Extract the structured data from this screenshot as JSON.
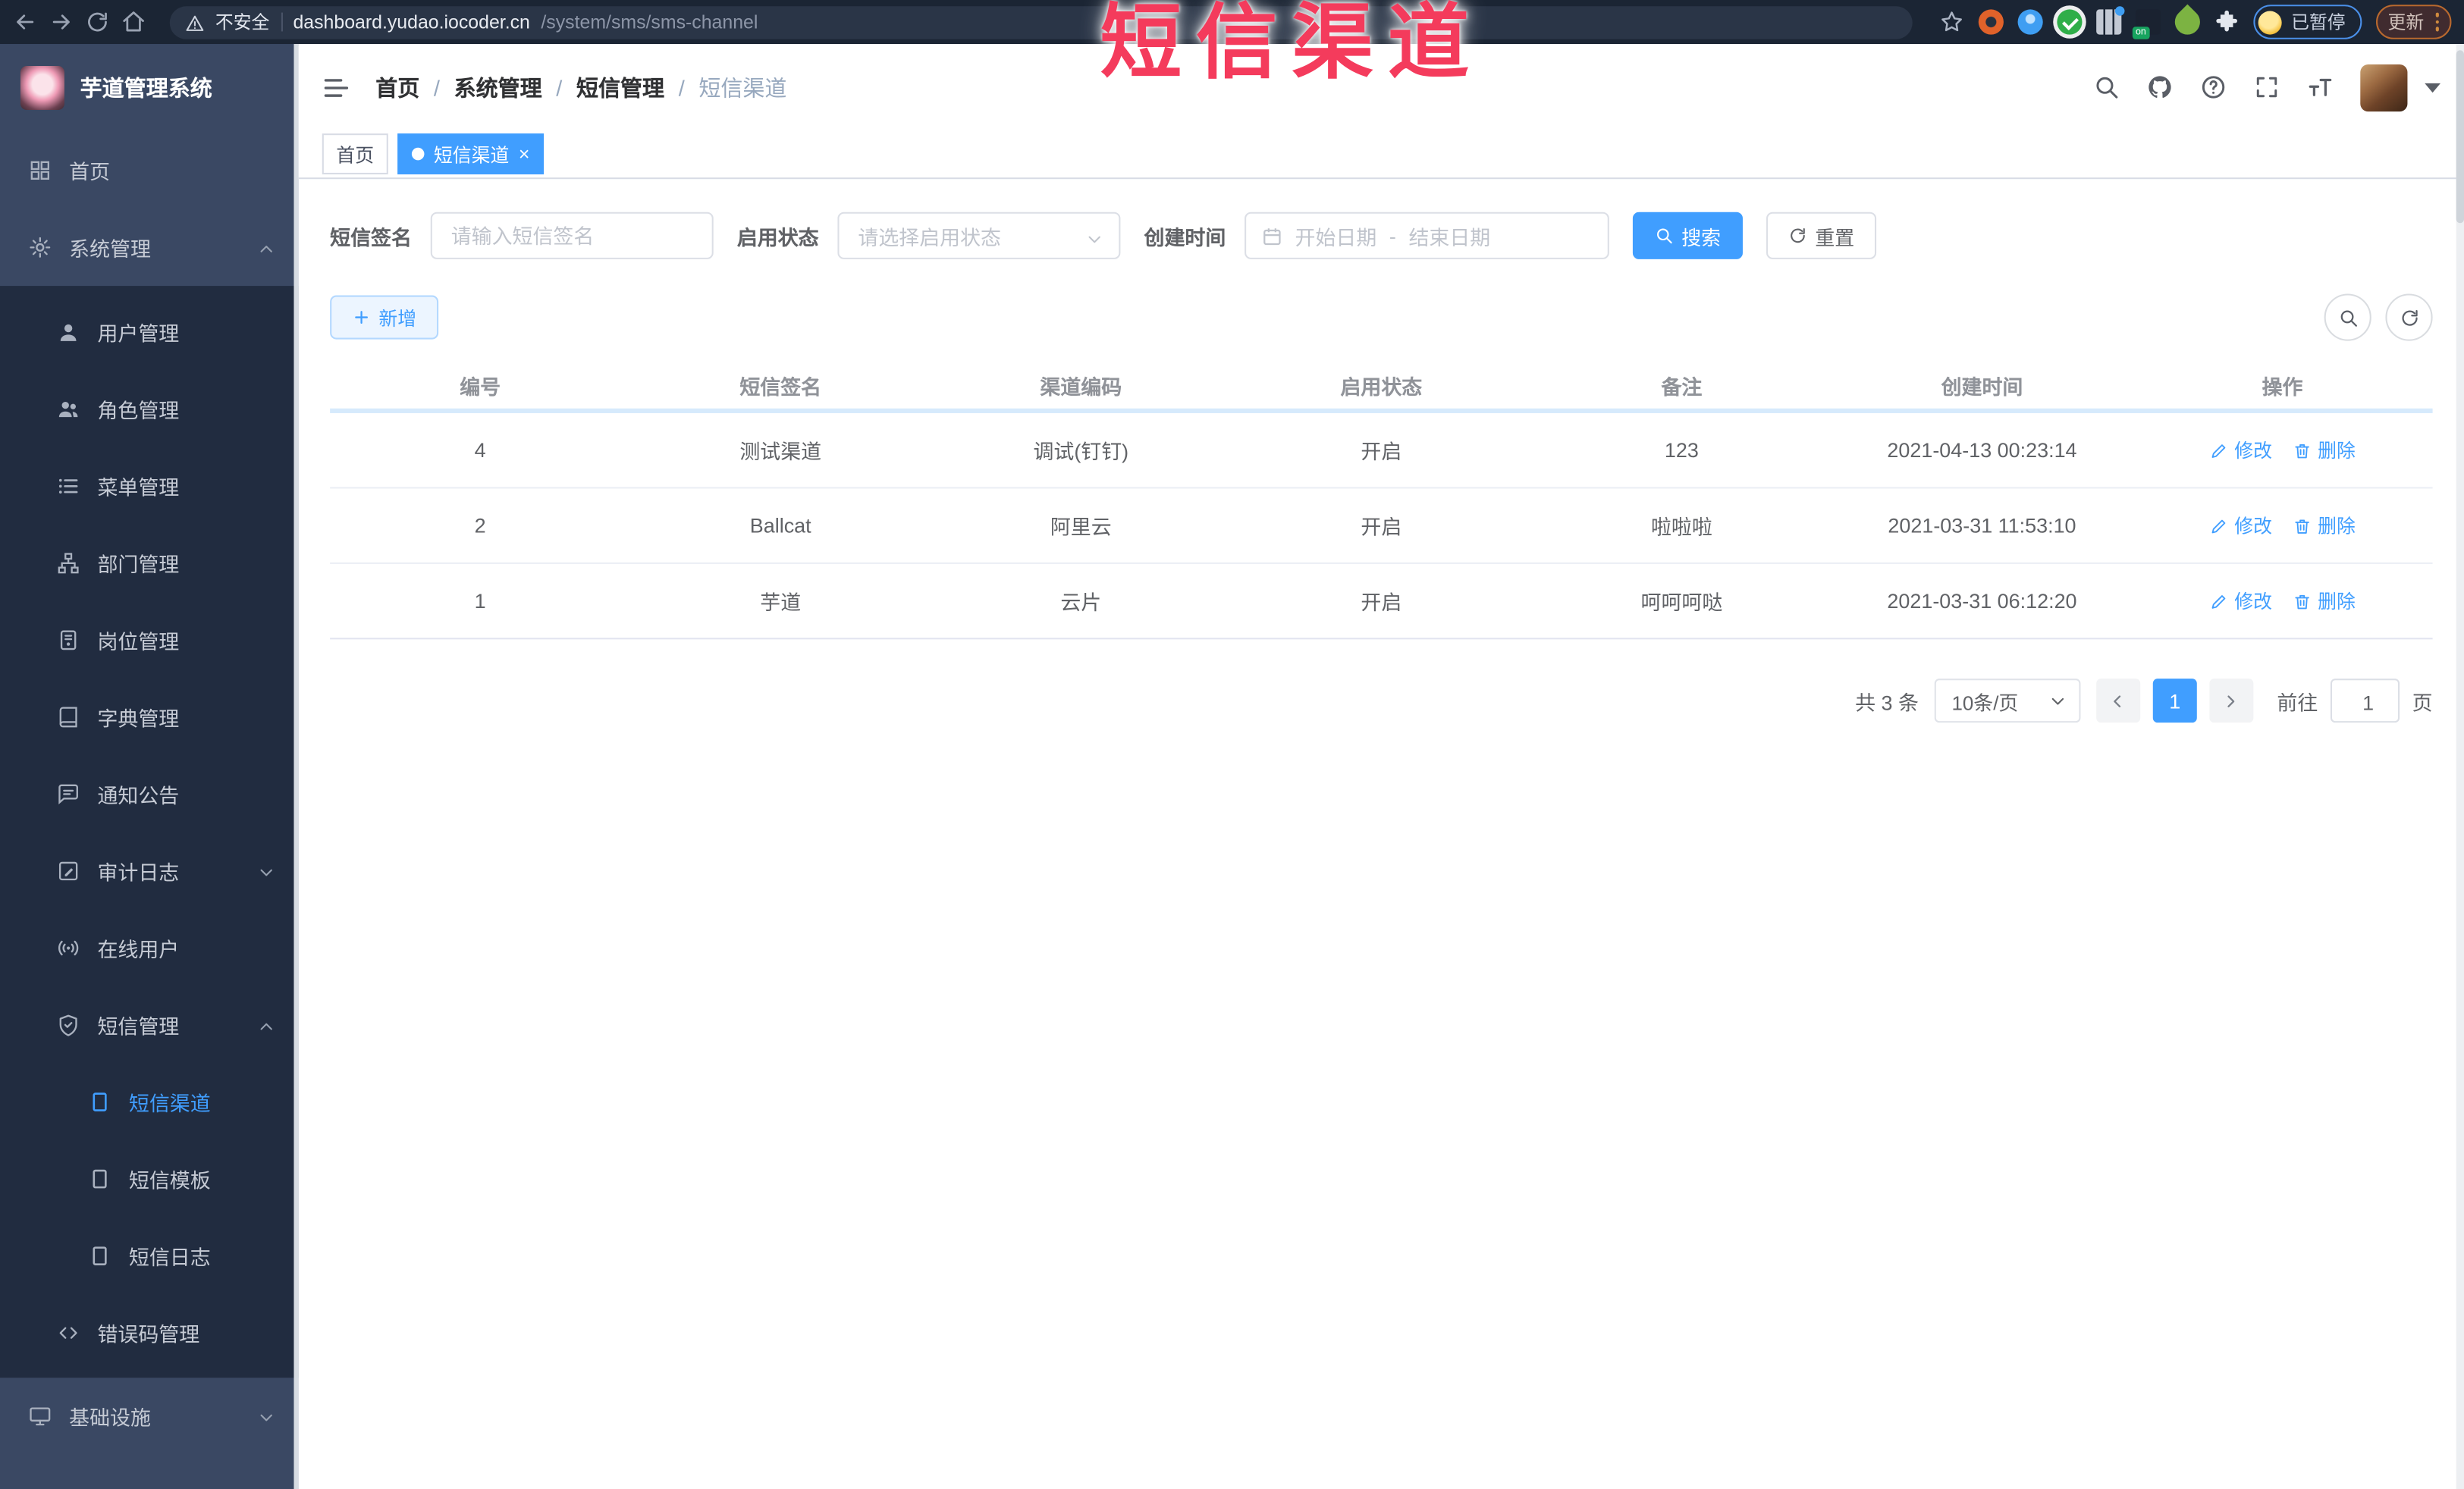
{
  "browser": {
    "security_label": "不安全",
    "url_domain": "dashboard.yudao.iocoder.cn",
    "url_path": "/system/sms/sms-channel",
    "paused_chip_label": "已暂停",
    "update_button_label": "更新"
  },
  "annotation": {
    "text": "短信渠道",
    "color": "#f43b5c"
  },
  "colors": {
    "accent": "#409eff",
    "sidebar_bg": "#3a4863",
    "sidebar_submenu_bg": "#212c40",
    "chrome_bg": "#1b2534",
    "table_header_divider": "#d6eafc"
  },
  "sidebar": {
    "logo_title": "芋道管理系统",
    "items": [
      {
        "label": "首页"
      },
      {
        "label": "系统管理"
      },
      {
        "label": "用户管理"
      },
      {
        "label": "角色管理"
      },
      {
        "label": "菜单管理"
      },
      {
        "label": "部门管理"
      },
      {
        "label": "岗位管理"
      },
      {
        "label": "字典管理"
      },
      {
        "label": "通知公告"
      },
      {
        "label": "审计日志"
      },
      {
        "label": "在线用户"
      },
      {
        "label": "短信管理"
      },
      {
        "label": "短信渠道",
        "active": true
      },
      {
        "label": "短信模板"
      },
      {
        "label": "短信日志"
      },
      {
        "label": "错误码管理"
      },
      {
        "label": "基础设施"
      }
    ]
  },
  "header": {
    "breadcrumb": [
      "首页",
      "系统管理",
      "短信管理",
      "短信渠道"
    ],
    "separator": "/"
  },
  "tabs": {
    "home": "首页",
    "active": "短信渠道",
    "close": "×"
  },
  "filters": {
    "sign_label": "短信签名",
    "sign_placeholder": "请输入短信签名",
    "status_label": "启用状态",
    "status_placeholder": "请选择启用状态",
    "time_label": "创建时间",
    "start_placeholder": "开始日期",
    "range_separator": "-",
    "end_placeholder": "结束日期",
    "search_label": "搜索",
    "reset_label": "重置"
  },
  "toolbar": {
    "add_label": "新增"
  },
  "table": {
    "columns": [
      "编号",
      "短信签名",
      "渠道编码",
      "启用状态",
      "备注",
      "创建时间",
      "操作"
    ],
    "actions": {
      "edit": "修改",
      "delete": "删除"
    },
    "rows": [
      {
        "id": "4",
        "sign": "测试渠道",
        "code": "调试(钉钉)",
        "status": "开启",
        "remark": "123",
        "created": "2021-04-13 00:23:14"
      },
      {
        "id": "2",
        "sign": "Ballcat",
        "code": "阿里云",
        "status": "开启",
        "remark": "啦啦啦",
        "created": "2021-03-31 11:53:10"
      },
      {
        "id": "1",
        "sign": "芋道",
        "code": "云片",
        "status": "开启",
        "remark": "呵呵呵哒",
        "created": "2021-03-31 06:12:20"
      }
    ]
  },
  "pagination": {
    "total_text": "共 3 条",
    "page_size": "10条/页",
    "current_page": "1",
    "goto_label": "前往",
    "goto_value": "1",
    "page_suffix": "页"
  }
}
